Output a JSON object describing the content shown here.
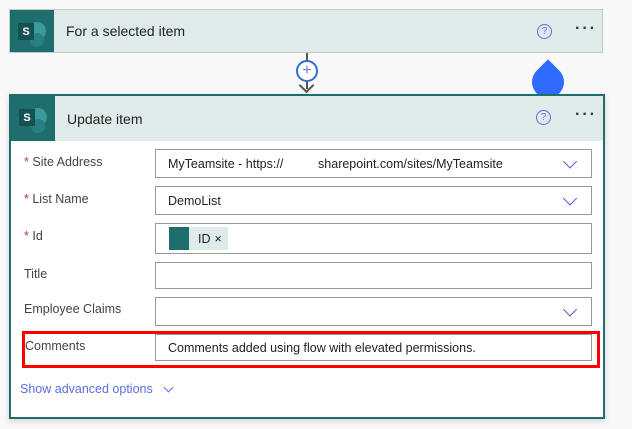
{
  "trigger": {
    "title": "For a selected item",
    "help_icon": "?",
    "more_icon": "···"
  },
  "action": {
    "title": "Update item",
    "help_icon": "?",
    "more_icon": "···",
    "fields": [
      {
        "label": "Site Address",
        "required": true,
        "value": "MyTeamsite - https://          sharepoint.com/sites/MyTeamsite",
        "dropdown": true
      },
      {
        "label": "List Name",
        "required": true,
        "value": "DemoList",
        "dropdown": true
      },
      {
        "label": "Id",
        "required": true,
        "token": "ID",
        "token_remove": "×"
      },
      {
        "label": "Title",
        "required": false,
        "value": ""
      },
      {
        "label": "Employee Claims",
        "required": false,
        "value": "",
        "dropdown": true
      },
      {
        "label": "Comments",
        "required": false,
        "value": "Comments added using flow with elevated permissions."
      }
    ],
    "required_mark": "*",
    "advanced": "Show advanced options"
  },
  "colors": {
    "teal": "#1f6e6e",
    "highlight": "#ff0000",
    "link": "#5b6ee1"
  }
}
